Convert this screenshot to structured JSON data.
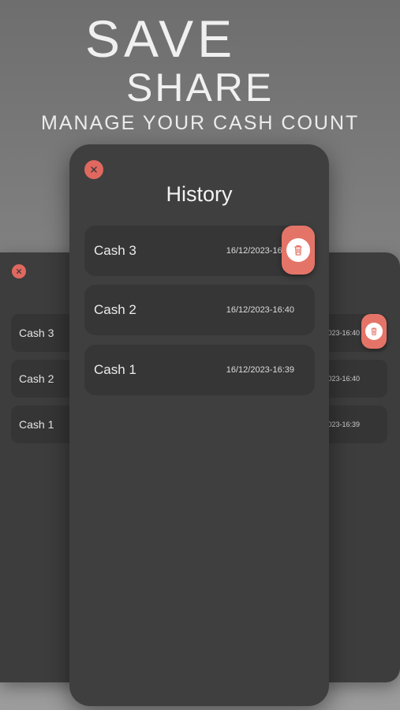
{
  "hero": {
    "line1": "SAVE",
    "line2": "SHARE",
    "line3": "MANAGE YOUR CASH COUNT"
  },
  "main": {
    "title": "History",
    "rows": [
      {
        "name": "Cash 3",
        "date": "16/12/2023-16:40"
      },
      {
        "name": "Cash 2",
        "date": "16/12/2023-16:40"
      },
      {
        "name": "Cash 1",
        "date": "16/12/2023-16:39"
      }
    ]
  },
  "left_preview": {
    "rows": [
      {
        "name": "Cash 3"
      },
      {
        "name": "Cash 2"
      },
      {
        "name": "Cash 1"
      }
    ]
  },
  "right_preview": {
    "rows": [
      {
        "date": "/2023-16:40"
      },
      {
        "date": "/2023-16:40"
      },
      {
        "date": "/2023-16:39"
      }
    ]
  },
  "icons": {
    "close": "close-icon",
    "delete": "trash-icon"
  },
  "colors": {
    "accent": "#e57468",
    "card": "#3f3f3f",
    "row": "#363636"
  }
}
